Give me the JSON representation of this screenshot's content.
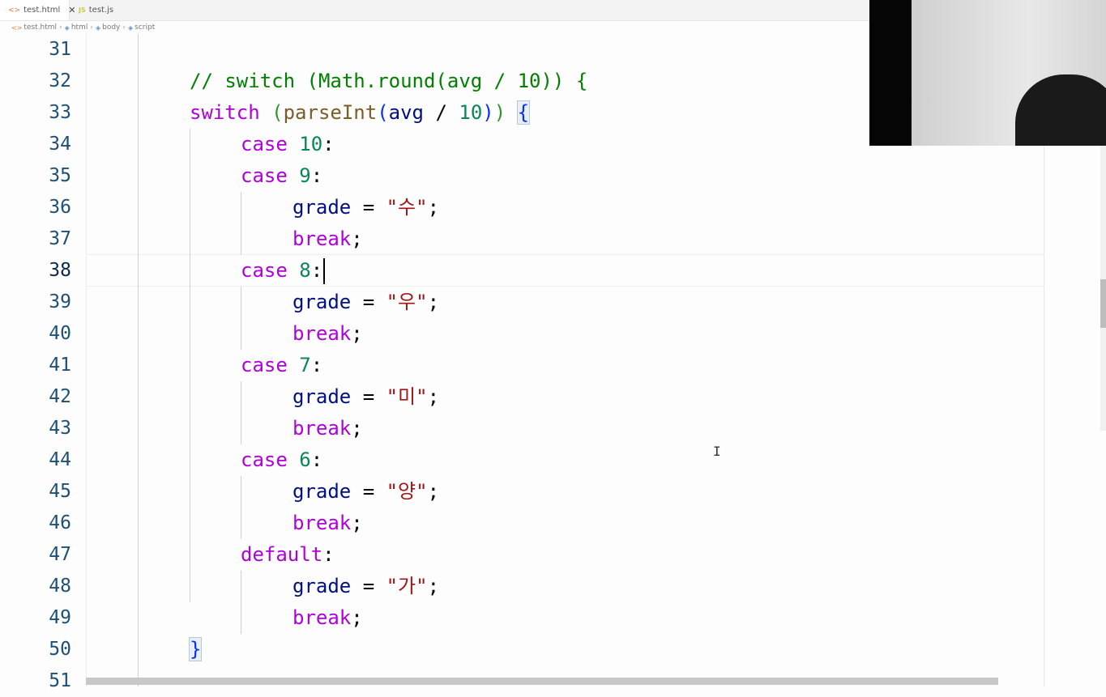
{
  "tabs": [
    {
      "label": "test.html",
      "icon": "html-file-icon",
      "active": true
    },
    {
      "label": "test.js",
      "icon": "js-file-icon",
      "active": false
    }
  ],
  "breadcrumb": [
    "test.html",
    "html",
    "body",
    "script"
  ],
  "code_lines": [
    {
      "n": "31"
    },
    {
      "n": "32"
    },
    {
      "n": "33"
    },
    {
      "n": "34"
    },
    {
      "n": "35"
    },
    {
      "n": "36"
    },
    {
      "n": "37"
    },
    {
      "n": "38"
    },
    {
      "n": "39"
    },
    {
      "n": "40"
    },
    {
      "n": "41"
    },
    {
      "n": "42"
    },
    {
      "n": "43"
    },
    {
      "n": "44"
    },
    {
      "n": "45"
    },
    {
      "n": "46"
    },
    {
      "n": "47"
    },
    {
      "n": "48"
    },
    {
      "n": "49"
    },
    {
      "n": "50"
    },
    {
      "n": "51"
    }
  ],
  "code": {
    "l32_comment": "// switch (Math.round(avg / 10)) {",
    "kw_switch": "switch",
    "fn_parseInt": "parseInt",
    "var_avg": "avg",
    "num_10": "10",
    "kw_case": "case",
    "kw_break": "break",
    "kw_default": "default",
    "var_grade": "grade",
    "str_su": "\"수\"",
    "str_u": "\"우\"",
    "str_mi": "\"미\"",
    "str_yang": "\"양\"",
    "str_ga": "\"가\"",
    "num_9": "9",
    "num_8": "8",
    "num_7": "7",
    "num_6": "6"
  },
  "current_line": "38"
}
